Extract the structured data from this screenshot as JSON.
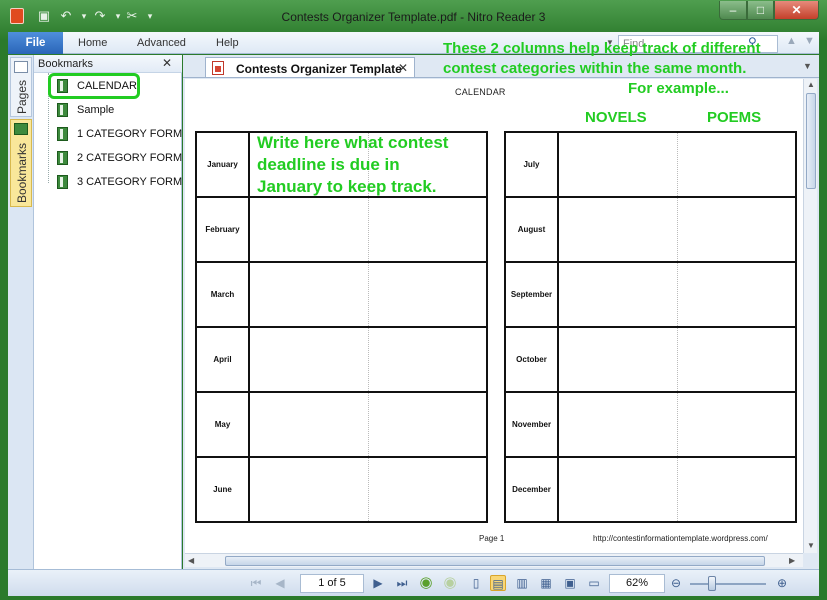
{
  "window": {
    "title": "Contests Organizer Template.pdf - Nitro Reader 3",
    "min_glyph": "–",
    "max_glyph": "□",
    "close_glyph": "✕"
  },
  "quick_access": {
    "save_glyph": "▣",
    "undo_glyph": "↶",
    "redo_glyph": "↷",
    "cut_glyph": "✂",
    "dropdown_glyph": "▾"
  },
  "ribbon": {
    "tabs": [
      "File",
      "Home",
      "Advanced",
      "Help"
    ],
    "find_placeholder": "Find",
    "find_icon": "search-icon"
  },
  "rail": {
    "tabs": [
      "Pages",
      "Bookmarks"
    ]
  },
  "bookmarks": {
    "title": "Bookmarks",
    "close_glyph": "✕",
    "items": [
      "CALENDAR",
      "Sample",
      "1 CATEGORY FORM",
      "2 CATEGORY FORM",
      "3 CATEGORY FORM"
    ]
  },
  "document": {
    "tab_label": "Contests Organizer Template",
    "tab_close": "✕",
    "heading": "CALENDAR",
    "column_heads": [
      "NOVELS",
      "POEMS"
    ],
    "annotation_top": [
      "These 2 columns help keep track of different",
      "contest categories within the same month.",
      "For example..."
    ],
    "annotation_cell": [
      "Write here what contest",
      "deadline is due in",
      "January to keep track."
    ],
    "months_left": [
      "January",
      "February",
      "March",
      "April",
      "May",
      "June"
    ],
    "months_right": [
      "July",
      "August",
      "September",
      "October",
      "November",
      "December"
    ],
    "page_label": "Page 1",
    "footer_url": "http://contestinformationtemplate.wordpress.com/"
  },
  "statusbar": {
    "page_value": "1 of 5",
    "zoom_value": "62%",
    "zoom_out": "⊖",
    "zoom_in": "⊕"
  },
  "colors": {
    "annotation": "#22cc22",
    "window_frame": "#2b7a2b",
    "file_tab": "#2a65b8"
  }
}
